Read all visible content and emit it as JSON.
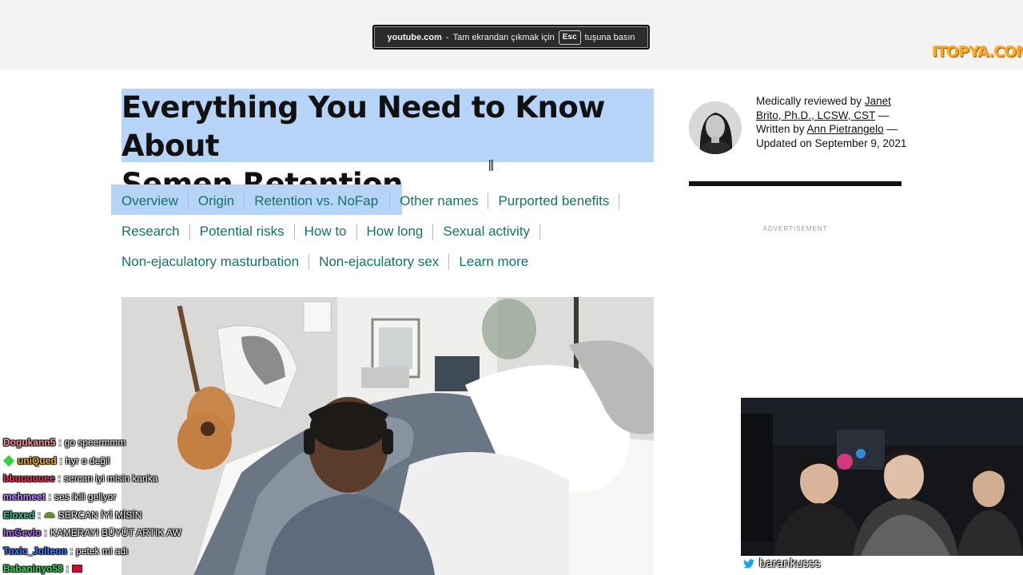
{
  "browser": {
    "fullscreen_notice": {
      "domain": "youtube.com",
      "separator": "-",
      "before_key": "Tam ekrandan çıkmak için",
      "key": "Esc",
      "after_key": "tuşuna basın"
    },
    "watermark": "ITOPYA.COM"
  },
  "article": {
    "title_line1": "Everything You Need to Know About",
    "title_line2": "Semen Retention",
    "toc": {
      "row1": [
        "Overview",
        "Origin",
        "Retention vs. NoFap",
        "Other names",
        "Purported benefits"
      ],
      "row2": [
        "Research",
        "Potential risks",
        "How to",
        "How long",
        "Sexual activity"
      ],
      "row3": [
        "Non-ejaculatory masturbation",
        "Non-ejaculatory sex",
        "Learn more"
      ]
    }
  },
  "sidebar": {
    "reviewed_prefix": "Medically reviewed by",
    "reviewer": "Janet Brito, Ph.D., LCSW, CST",
    "written_prefix": "— Written by",
    "author": "Ann Pietrangelo",
    "updated": "— Updated on September 9, 2021",
    "ad_label": "ADVERTISEMENT"
  },
  "stream": {
    "twitter_handle": "barankusss"
  },
  "chat": [
    {
      "user": "Dogukann5",
      "color": "#ff9aa0",
      "message": "go speermmm",
      "badge": ""
    },
    {
      "user": "uniQued",
      "color": "#ffb020",
      "message": "hyr o değil",
      "badge": "diamond"
    },
    {
      "user": "bbuuuuuee",
      "color": "#ff3355",
      "message": "sercan iyi misin kanka",
      "badge": ""
    },
    {
      "user": "mehmeet",
      "color": "#c08cff",
      "message": "ses ikili geliyor",
      "badge": ""
    },
    {
      "user": "Eloxed",
      "color": "#34d0a0",
      "message": "SERCAN İYİ MİSİN",
      "badge": "emote"
    },
    {
      "user": "ImGevio",
      "color": "#b070ff",
      "message": "KAMERAYI BÜYÜT ARTIK AW",
      "badge": ""
    },
    {
      "user": "Toxic_Jolteon",
      "color": "#3f7fff",
      "message": "petek mi adı",
      "badge": ""
    },
    {
      "user": "Babaninyo58",
      "color": "#33e060",
      "message": "",
      "badge": "flag"
    }
  ]
}
